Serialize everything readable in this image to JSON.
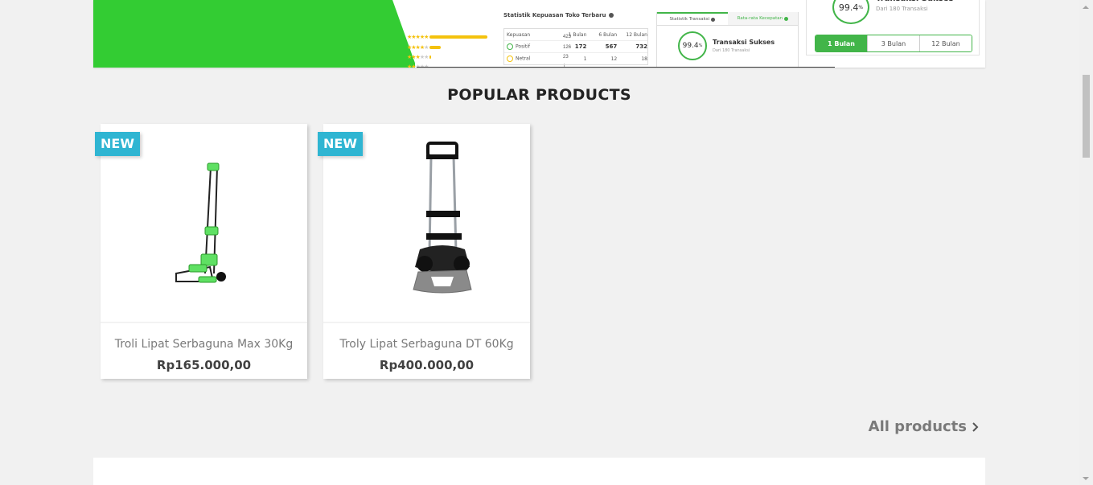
{
  "banner": {
    "stats_title": "Statistik Kepuasan Toko Terbaru",
    "star_counts": [
      "423",
      "126",
      "23",
      "1"
    ],
    "table": {
      "headers": [
        "Kepuasan",
        "1 Bulan",
        "6 Bulan",
        "12 Bulan"
      ],
      "rows": [
        {
          "label": "Positif",
          "values": [
            "172",
            "567",
            "732"
          ]
        },
        {
          "label": "Netral",
          "values": [
            "1",
            "12",
            "18"
          ]
        }
      ]
    },
    "stat_tabs": [
      "Statistik Transaksi",
      "Rata-rata Kecepatan"
    ],
    "success_rate": "99.4",
    "success_unit": "%",
    "success_label": "Transaksi Sukses",
    "success_sub": "Dari 180 Transaksi",
    "periods": [
      "1 Bulan",
      "3 Bulan",
      "12 Bulan"
    ],
    "selected_period": "1 Bulan",
    "colors": {
      "brand_green": "#33cc33",
      "accent_green": "#42b549",
      "star": "#f4c20d"
    }
  },
  "section": {
    "title": "POPULAR PRODUCTS"
  },
  "products": [
    {
      "badge": "NEW",
      "name": "Troli Lipat Serbaguna Max 30Kg",
      "price": "Rp165.000,00",
      "image": "green-folding-trolley"
    },
    {
      "badge": "NEW",
      "name": "Troly Lipat Serbaguna DT 60Kg",
      "price": "Rp400.000,00",
      "image": "grey-folding-trolley"
    }
  ],
  "all_products": {
    "label": "All products",
    "icon": "chevron-right-icon"
  },
  "badge_color": "#2fb5d2"
}
